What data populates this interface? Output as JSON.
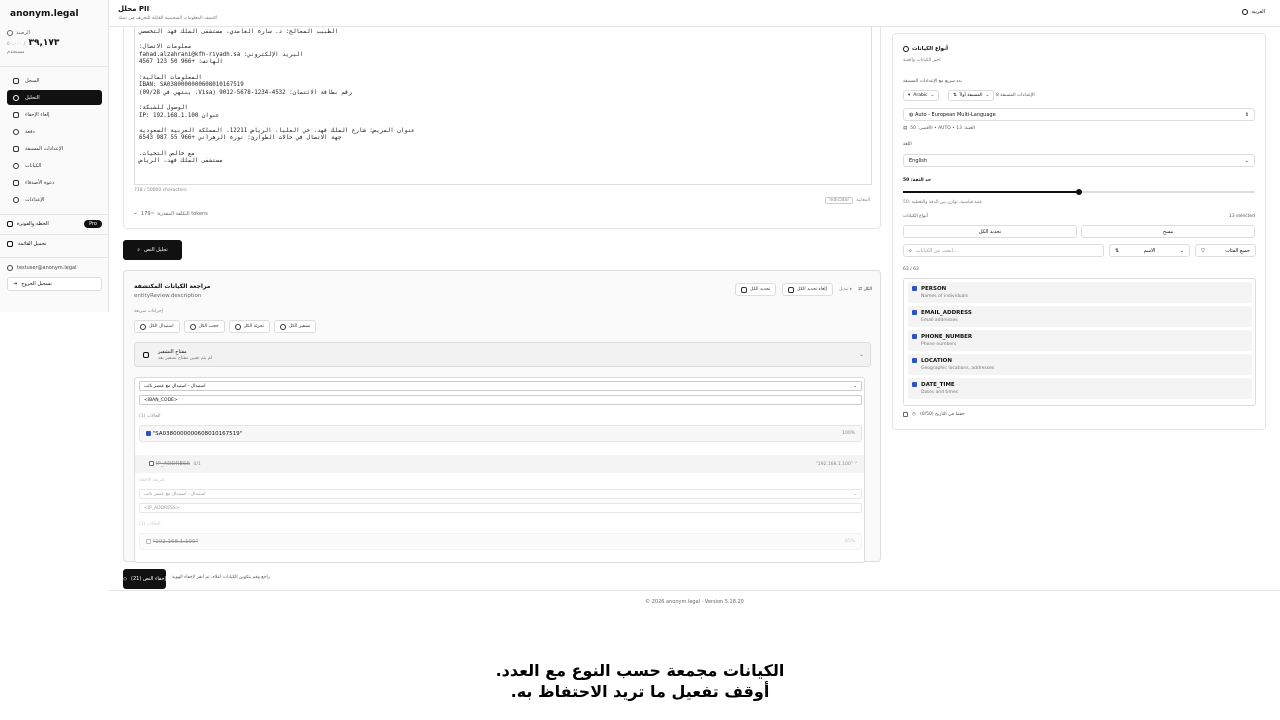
{
  "app": {
    "brand": "anonym.legal"
  },
  "credits": {
    "label": "الرصيد",
    "value": "٣٩,١٧٣",
    "max": "/ ٥٠,٠٠٠",
    "sub": "مستخدم"
  },
  "nav": [
    {
      "label": "السجل",
      "icon": "history-icon"
    },
    {
      "label": "التحليل",
      "icon": "shield-icon",
      "active": true
    },
    {
      "label": "إلغاء الإخفاء",
      "icon": "unlock-icon"
    },
    {
      "label": "دفعة",
      "icon": "layers-icon"
    },
    {
      "label": "الإعدادات المسبقة",
      "icon": "sliders-icon"
    },
    {
      "label": "الكيانات",
      "icon": "tag-icon"
    },
    {
      "label": "دعوة الأصدقاء",
      "icon": "gift-icon"
    },
    {
      "label": "الإعدادات",
      "icon": "gear-icon"
    }
  ],
  "plan": {
    "label": "الخطة والفوترة",
    "badge": "Pro"
  },
  "upgrade": {
    "label": "تحميل القائمة"
  },
  "user": {
    "email": "testuser@anonym.legal",
    "logout": "تسجيل الخروج"
  },
  "header": {
    "title": "محلل PII",
    "subtitle": "اكتشف المعلومات الشخصية القابلة للتعريف في نصك",
    "lang": "العربية"
  },
  "editor": {
    "lines": [
      "الطبيب المعالج: د. سارة الغامدي، مستشفى الملك فهد التخصصي",
      "",
      "معلومات الاتصال:",
      "البريد الإلكتروني: fahad.alzahrani@kfh-riyadh.sa",
      "الهاتف: +966 50 123 4567",
      "",
      "المعلومات المالية:",
      "IBAN: SA0380000000608010167519",
      "رقم بطاقة الائتمان: 4532-1234-5678-9012 (Visa، ينتهي في 09/28)",
      "",
      "الوصول للشبكة:",
      "عنوان IP: 192.168.1.100",
      "",
      "عنوان المريض: شارع الملك فهد، حي العليا، الرياض 12211، المملكة العربية السعودية",
      "جهة الاتصال في حالات الطوارئ: نورة الزهراني +966 55 987 6543",
      "",
      "مع خالص التحيات،",
      "مستشفى الملك فهد، الرياض"
    ],
    "char_count": "718 / 50000 characters",
    "tokens": "التكلفة المقدرة: ~179 tokens",
    "preview_label": "المعاينة",
    "preview_badge": "Indicator",
    "analyze_button": "تحليل النص"
  },
  "review": {
    "title": "مراجعة الكيانات المكتشفة",
    "desc": "entityReview.description",
    "all_label": "الكل",
    "tog": "تبديل",
    "deselect_all": "إلغاء تحديد الكل",
    "select_all": "تحديد الكل",
    "quick_label": "إجراءات سريعة",
    "quick": [
      "استبدال الكل",
      "حجب الكل",
      "تجزئة الكل",
      "تشفير الكل"
    ],
    "enc_title": "مفتاح التشفير",
    "enc_sub": "لم يتم تعيين مفتاح تشفير بعد",
    "g1": {
      "method": "استبدال - استبدال مع عنصر نائب",
      "value": "<IBAN_CODE>",
      "instances": "الحالات (1)",
      "match": "\"SA0380000000608010167519\"",
      "score": "100%"
    },
    "g2": {
      "label": "IP_ADDRESS",
      "count": "0/1",
      "example": "\"192.168.1.100\"",
      "method_label": "طريقة الإخفاء",
      "method": "استبدال - استبدال مع عنصر نائب",
      "value": "<IP_ADDRESS>",
      "instances": "الحالات (1)",
      "match": "\"192.168.1.100\"",
      "score": "85%"
    }
  },
  "anonymize": {
    "button": "إخفاء النص (21)",
    "note": "راجع وقم بتكوين الكيانات أعلاه، ثم انقر لإخفاء الهوية"
  },
  "right": {
    "title": "أنواع الكيانات",
    "subtitle": "اختر الكيانات والعتبة",
    "preset_hint": "بدء سريع مع الإعدادات المسبقة",
    "preset_lang": "Arabic",
    "preset_sort": "المسبقة أولاً",
    "preset_count": "الإعدادات المسبقة 8",
    "model": "Auto - European Multi-Language",
    "model_info": "الأقصى: 50 • AUTO • العتبة: 13",
    "language_label": "اللغة",
    "language": "English",
    "threshold_label": "حد الثقة: 50",
    "threshold": 50,
    "threshold_note": "50: عتبة قياسية، توازن بين الدقة والتغطية",
    "types_label": "أنواع الكيانات",
    "selected": "13 selected",
    "select_all": "تحديد الكل",
    "clear": "مسح",
    "search_placeholder": "ابحث عن الكيانات...",
    "sort": "الاسم",
    "all_groups": "جميع الفئات",
    "count": "63 / 63",
    "entities": [
      {
        "name": "PERSON",
        "desc": "Names of individuals"
      },
      {
        "name": "EMAIL_ADDRESS",
        "desc": "Email addresses"
      },
      {
        "name": "PHONE_NUMBER",
        "desc": "Phone numbers"
      },
      {
        "name": "LOCATION",
        "desc": "Geographic locations, addresses"
      },
      {
        "name": "DATE_TIME",
        "desc": "Dates and times"
      }
    ],
    "save_history": "حفظ في التاريخ (0/50)"
  },
  "footer": {
    "text": "© 2026 anonym.legal · Version 5.18.20"
  },
  "caption": {
    "line1": ".الكيانات مجمعة حسب النوع مع العدد",
    "line2": ".أوقف تفعيل ما تريد الاحتفاظ به"
  }
}
